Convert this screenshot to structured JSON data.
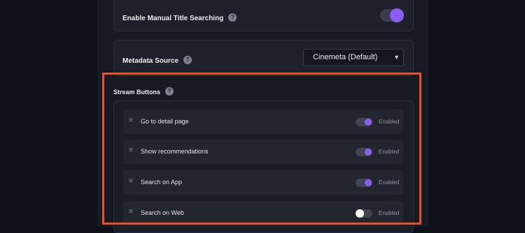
{
  "settings": {
    "manual_search": {
      "label": "Enable Manual Title Searching",
      "help": "?",
      "enabled": true
    },
    "metadata_source": {
      "label": "Metadata Source",
      "help": "?",
      "selected": "Cinemeta (Default)"
    }
  },
  "stream_buttons": {
    "title": "Stream Buttons",
    "help": "?",
    "items": [
      {
        "label": "Go to detail page",
        "enabled": true,
        "state": "Enabled"
      },
      {
        "label": "Show recommendations",
        "enabled": true,
        "state": "Enabled"
      },
      {
        "label": "Search on App",
        "enabled": true,
        "state": "Enabled"
      },
      {
        "label": "Search on Web",
        "enabled": false,
        "state": "Enabled"
      }
    ]
  },
  "colors": {
    "accent": "#8b5cf6",
    "highlight": "#e8502c",
    "background": "#0e1118"
  },
  "icons": {
    "drag_handle": "≡",
    "dropdown": "chevron-down-icon"
  }
}
